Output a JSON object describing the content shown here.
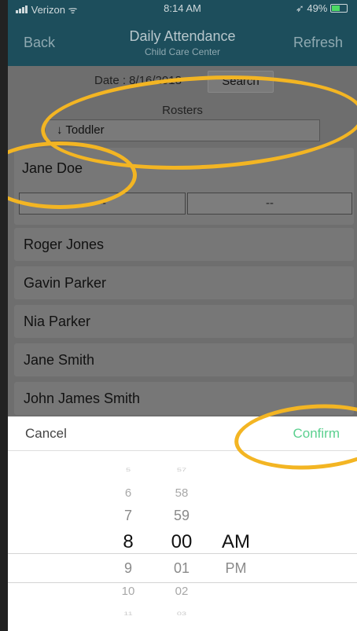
{
  "status_bar": {
    "carrier": "Verizon",
    "time": "8:14 AM",
    "battery": "49%"
  },
  "nav": {
    "back_label": "Back",
    "title": "Daily Attendance",
    "subtitle": "Child Care Center",
    "refresh_label": "Refresh"
  },
  "filters": {
    "date_text": "Date : 8/16/2018",
    "search_label": "Search",
    "rosters_label": "Rosters",
    "roster_value": "↓  Toddler"
  },
  "selected_child": {
    "name": "Jane Doe",
    "check_in": "--",
    "check_out": "--"
  },
  "children": [
    {
      "name": "Roger Jones"
    },
    {
      "name": "Gavin Parker"
    },
    {
      "name": "Nia Parker"
    },
    {
      "name": "Jane Smith"
    },
    {
      "name": "John James Smith"
    }
  ],
  "picker": {
    "cancel_label": "Cancel",
    "confirm_label": "Confirm",
    "hours": [
      "5",
      "6",
      "7",
      "8",
      "9",
      "10",
      "11"
    ],
    "minutes": [
      "57",
      "58",
      "59",
      "00",
      "01",
      "02",
      "03"
    ],
    "ampm": [
      "AM",
      "PM"
    ],
    "selected": {
      "hour": "8",
      "minute": "00",
      "period": "AM"
    }
  },
  "colors": {
    "nav_bg": "#1d4e5c",
    "highlight": "#f3b523",
    "confirm": "#5bd08f"
  }
}
